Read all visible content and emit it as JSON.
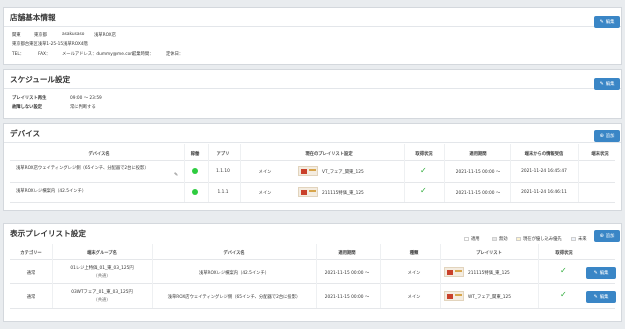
{
  "store": {
    "title": "店舗基本情報",
    "edit_label": "編集",
    "line1": [
      "関東",
      "東京都",
      "asakusaso",
      "浅草ROX店"
    ],
    "address": "東京都台東区浅草1-25-15浅草ROX4階",
    "tel": "TEL：",
    "fax": "FAX：",
    "mail": "メールアドレス：dummy@me.com",
    "hours": "営業時間：",
    "closed": "定休日："
  },
  "schedule": {
    "title": "スケジュール設定",
    "edit_label": "編集",
    "rows": [
      {
        "label": "プレイリスト再生",
        "value": "09:00 〜 23:59"
      },
      {
        "label": "故障しない設定",
        "value": "常に判断する"
      }
    ]
  },
  "devices": {
    "title": "デバイス",
    "add_label": "追加",
    "headers": [
      "デバイス名",
      "稼働",
      "アプリ",
      "現在のプレイリスト設定",
      "取得状況",
      "適用期間",
      "端末からの情報受信",
      "端末状況"
    ],
    "rows": [
      {
        "name": "浅草ROX店ウェイティングレジ側（65インチ、分配器で2台に投影）",
        "active": true,
        "app": "1.1.10",
        "mode": "メイン",
        "playlist": "VT_フェア_関東_125",
        "status": "ok",
        "period": "2021-11-15 00:00 〜",
        "received": "2021-11-24 16:45:47"
      },
      {
        "name": "浅草ROXレジ横案内（42.5インチ）",
        "active": true,
        "app": "1.1.1",
        "mode": "メイン",
        "playlist": "211115特価_東_125",
        "status": "ok",
        "period": "2021-11-15 00:00 〜",
        "received": "2021-11-24 16:46:11"
      }
    ]
  },
  "display": {
    "title": "表示プレイリスト設定",
    "add_label": "追加",
    "legend": [
      "適用",
      "無効",
      "現在が優し込み優先",
      "未来"
    ],
    "headers": [
      "カテゴリー",
      "端末グループ名",
      "デバイス名",
      "適用期間",
      "種類",
      "プレイリスト",
      "取得状況"
    ],
    "rows": [
      {
        "category": "通常",
        "group": "01レジ上特価_01_東_03_125円",
        "group_sub": "(共通)",
        "device": "浅草ROXレジ横案内（42.5インチ）",
        "period": "2021-11-15 00:00 〜",
        "kind": "メイン",
        "playlist": "211115特価_東_125",
        "status": "ok",
        "edit_label": "編集"
      },
      {
        "category": "通常",
        "group": "03WTフェア_01_東_03_125円",
        "group_sub": "(共通)",
        "device": "浅草ROX店ウェイティングレジ側（65インチ、分配器で2台に投影）",
        "period": "2021-11-15 00:00 〜",
        "kind": "メイン",
        "playlist": "WT_フェア_関東_125",
        "status": "ok",
        "edit_label": "編集"
      }
    ]
  },
  "colors": {
    "button": "#3a86c6",
    "active": "#2ecc40",
    "check": "#2eab3a"
  },
  "icons": {
    "edit": "pencil-icon",
    "add": "plus-icon",
    "check": "check-icon"
  }
}
